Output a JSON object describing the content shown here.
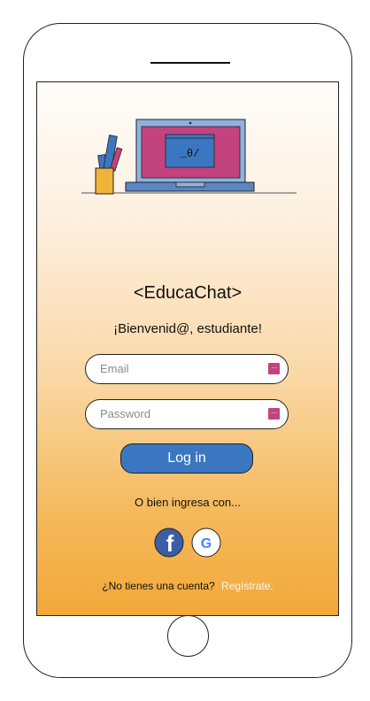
{
  "app": {
    "title": "<EducaChat>",
    "welcome": "¡Bienvenid@, estudiante!",
    "laptop_screen_text": "_θ/"
  },
  "form": {
    "email_placeholder": "Email",
    "password_placeholder": "Password",
    "field_action_glyph": "···",
    "login_label": "Log in"
  },
  "social": {
    "prompt": "O bien ingresa con...",
    "facebook_glyph": "f",
    "google_glyph": "G"
  },
  "footer": {
    "question": "¿No tienes una cuenta?",
    "register_link": "Regístrate."
  },
  "colors": {
    "accent_magenta": "#c2437e",
    "button_blue": "#3b77c0",
    "gradient_bottom": "#f2a838"
  }
}
